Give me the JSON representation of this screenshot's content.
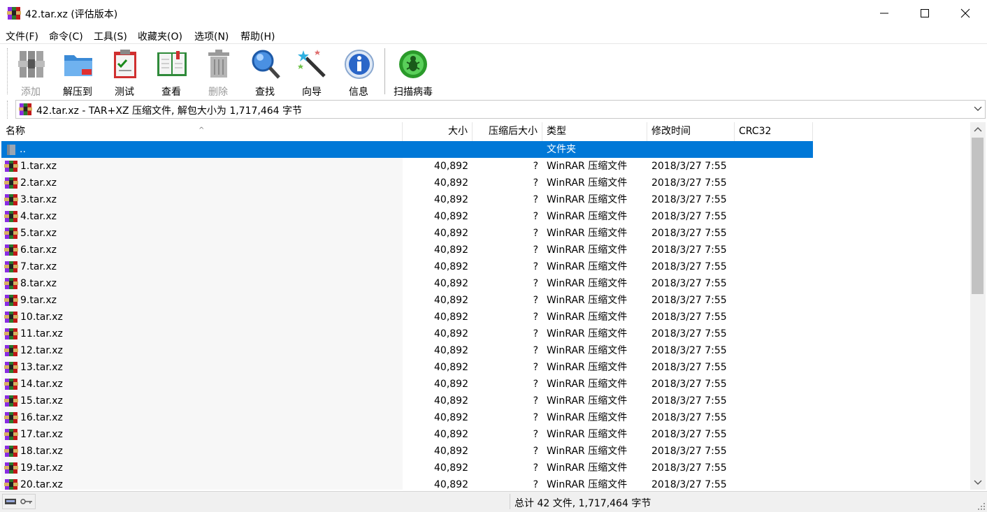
{
  "window": {
    "title": "42.tar.xz (评估版本)"
  },
  "menu": [
    "文件(F)",
    "命令(C)",
    "工具(S)",
    "收藏夹(O)",
    "选项(N)",
    "帮助(H)"
  ],
  "toolbar": [
    {
      "label": "添加",
      "icon": "add-archive-icon",
      "disabled": true
    },
    {
      "label": "解压到",
      "icon": "extract-folder-icon",
      "disabled": false
    },
    {
      "label": "测试",
      "icon": "test-clipboard-icon",
      "disabled": false
    },
    {
      "label": "查看",
      "icon": "view-book-icon",
      "disabled": false
    },
    {
      "label": "删除",
      "icon": "trash-icon",
      "disabled": true
    },
    {
      "label": "查找",
      "icon": "magnifier-icon",
      "disabled": false
    },
    {
      "label": "向导",
      "icon": "wizard-wand-icon",
      "disabled": false
    },
    {
      "label": "信息",
      "icon": "info-icon",
      "disabled": false
    },
    {
      "label": "扫描病毒",
      "icon": "virus-scan-icon",
      "disabled": false
    }
  ],
  "address": {
    "text": "42.tar.xz - TAR+XZ 压缩文件, 解包大小为 1,717,464 字节"
  },
  "columns": {
    "name": "名称",
    "size": "大小",
    "packed": "压缩后大小",
    "type": "类型",
    "modified": "修改时间",
    "crc": "CRC32"
  },
  "parent_row": {
    "name": "..",
    "type": "文件夹"
  },
  "files": [
    {
      "name": "1.tar.xz",
      "size": "40,892",
      "packed": "?",
      "type": "WinRAR 压缩文件",
      "modified": "2018/3/27 7:55"
    },
    {
      "name": "2.tar.xz",
      "size": "40,892",
      "packed": "?",
      "type": "WinRAR 压缩文件",
      "modified": "2018/3/27 7:55"
    },
    {
      "name": "3.tar.xz",
      "size": "40,892",
      "packed": "?",
      "type": "WinRAR 压缩文件",
      "modified": "2018/3/27 7:55"
    },
    {
      "name": "4.tar.xz",
      "size": "40,892",
      "packed": "?",
      "type": "WinRAR 压缩文件",
      "modified": "2018/3/27 7:55"
    },
    {
      "name": "5.tar.xz",
      "size": "40,892",
      "packed": "?",
      "type": "WinRAR 压缩文件",
      "modified": "2018/3/27 7:55"
    },
    {
      "name": "6.tar.xz",
      "size": "40,892",
      "packed": "?",
      "type": "WinRAR 压缩文件",
      "modified": "2018/3/27 7:55"
    },
    {
      "name": "7.tar.xz",
      "size": "40,892",
      "packed": "?",
      "type": "WinRAR 压缩文件",
      "modified": "2018/3/27 7:55"
    },
    {
      "name": "8.tar.xz",
      "size": "40,892",
      "packed": "?",
      "type": "WinRAR 压缩文件",
      "modified": "2018/3/27 7:55"
    },
    {
      "name": "9.tar.xz",
      "size": "40,892",
      "packed": "?",
      "type": "WinRAR 压缩文件",
      "modified": "2018/3/27 7:55"
    },
    {
      "name": "10.tar.xz",
      "size": "40,892",
      "packed": "?",
      "type": "WinRAR 压缩文件",
      "modified": "2018/3/27 7:55"
    },
    {
      "name": "11.tar.xz",
      "size": "40,892",
      "packed": "?",
      "type": "WinRAR 压缩文件",
      "modified": "2018/3/27 7:55"
    },
    {
      "name": "12.tar.xz",
      "size": "40,892",
      "packed": "?",
      "type": "WinRAR 压缩文件",
      "modified": "2018/3/27 7:55"
    },
    {
      "name": "13.tar.xz",
      "size": "40,892",
      "packed": "?",
      "type": "WinRAR 压缩文件",
      "modified": "2018/3/27 7:55"
    },
    {
      "name": "14.tar.xz",
      "size": "40,892",
      "packed": "?",
      "type": "WinRAR 压缩文件",
      "modified": "2018/3/27 7:55"
    },
    {
      "name": "15.tar.xz",
      "size": "40,892",
      "packed": "?",
      "type": "WinRAR 压缩文件",
      "modified": "2018/3/27 7:55"
    },
    {
      "name": "16.tar.xz",
      "size": "40,892",
      "packed": "?",
      "type": "WinRAR 压缩文件",
      "modified": "2018/3/27 7:55"
    },
    {
      "name": "17.tar.xz",
      "size": "40,892",
      "packed": "?",
      "type": "WinRAR 压缩文件",
      "modified": "2018/3/27 7:55"
    },
    {
      "name": "18.tar.xz",
      "size": "40,892",
      "packed": "?",
      "type": "WinRAR 压缩文件",
      "modified": "2018/3/27 7:55"
    },
    {
      "name": "19.tar.xz",
      "size": "40,892",
      "packed": "?",
      "type": "WinRAR 压缩文件",
      "modified": "2018/3/27 7:55"
    },
    {
      "name": "20.tar.xz",
      "size": "40,892",
      "packed": "?",
      "type": "WinRAR 压缩文件",
      "modified": "2018/3/27 7:55"
    }
  ],
  "status": {
    "text": "总计 42 文件, 1,717,464 字节"
  },
  "colors": {
    "selection": "#0078d7",
    "statusbar": "#f0f0f0"
  }
}
